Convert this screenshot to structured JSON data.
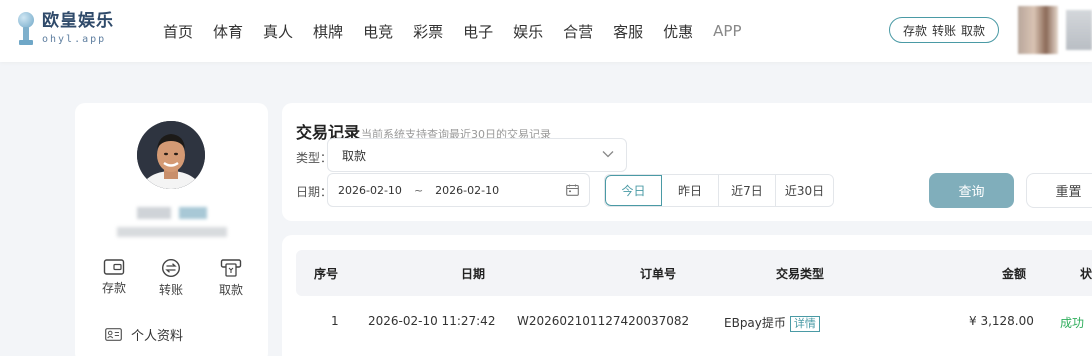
{
  "brand": {
    "name_cn": "欧皇娱乐",
    "name_en": "ohyl.app"
  },
  "nav": {
    "items": [
      "首页",
      "体育",
      "真人",
      "棋牌",
      "电竞",
      "彩票",
      "电子",
      "娱乐",
      "合营",
      "客服",
      "优惠",
      "APP"
    ]
  },
  "account_actions": {
    "deposit": "存款",
    "transfer": "转账",
    "withdraw": "取款"
  },
  "sidebar": {
    "quick_actions": [
      {
        "label": "存款",
        "icon": "wallet-icon"
      },
      {
        "label": "转账",
        "icon": "transfer-icon"
      },
      {
        "label": "取款",
        "icon": "withdraw-icon"
      }
    ],
    "menu": [
      {
        "label": "个人资料",
        "icon": "id-card-icon"
      }
    ]
  },
  "records": {
    "title": "交易记录",
    "subtitle": "当前系统支持查询最近30日的交易记录",
    "type_label": "类型：",
    "type_value": "取款",
    "date_label": "日期：",
    "date_start": "2026-02-10",
    "date_sep": "~",
    "date_end": "2026-02-10",
    "quick_ranges": [
      "今日",
      "昨日",
      "近7日",
      "近30日"
    ],
    "active_range": "今日",
    "query_button": "查询",
    "reset_button": "重置"
  },
  "table": {
    "headers": [
      "序号",
      "日期",
      "订单号",
      "交易类型",
      "金额",
      "状"
    ],
    "rows": [
      {
        "index": "1",
        "date": "2026-02-10 11:27:42",
        "order_no": "W202602101127420037082",
        "type": "EBpay提币",
        "detail": "详情",
        "amount": "¥ 3,128.00",
        "status": "成功"
      }
    ]
  },
  "colors": {
    "accent": "#4a9aa5",
    "success": "#2fae5c",
    "query_button": "#80aebb"
  }
}
